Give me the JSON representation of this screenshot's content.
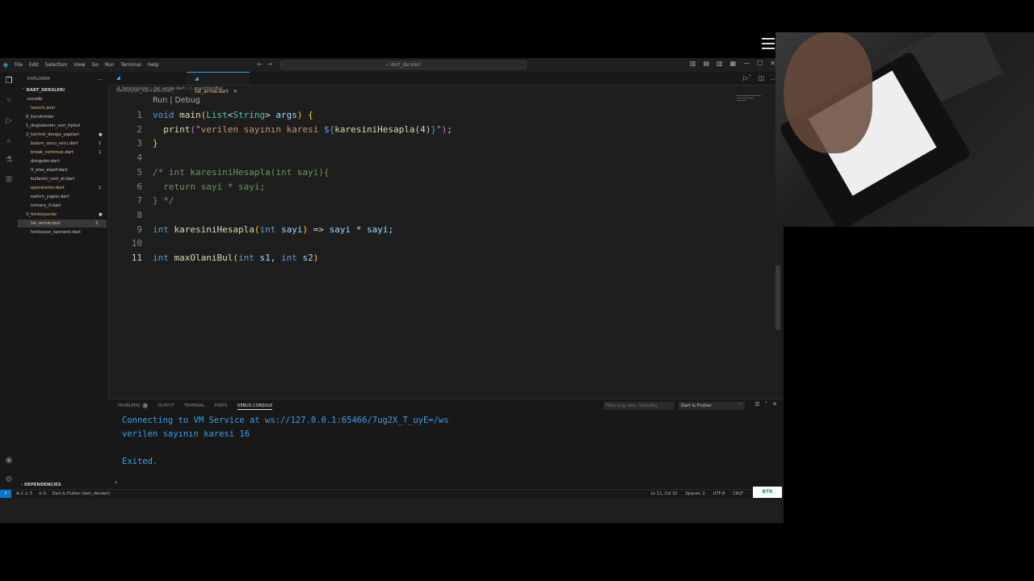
{
  "titlebar": {
    "menu": [
      "File",
      "Edit",
      "Selection",
      "View",
      "Go",
      "Run",
      "Terminal",
      "Help"
    ],
    "search": "dart_dersleri"
  },
  "sidebar": {
    "header": "EXPLORER",
    "project": "DART_DERSLERI",
    "items": [
      {
        "label": ".vscode",
        "color": "#cccccc",
        "indent": 1,
        "badge": ""
      },
      {
        "label": "launch.json",
        "color": "#e5c07b",
        "indent": 2,
        "badge": ""
      },
      {
        "label": "0_kurulumlar",
        "color": "#cccccc",
        "indent": 1,
        "badge": ""
      },
      {
        "label": "1_degiskenler_veri_tipleri",
        "color": "#cccccc",
        "indent": 1,
        "badge": ""
      },
      {
        "label": "2_kontrol_dongu_yapilari",
        "color": "#e2c08d",
        "indent": 1,
        "badge": "●"
      },
      {
        "label": "bolum_sonu_soru.dart",
        "color": "#e2c08d",
        "indent": 2,
        "badge": "1"
      },
      {
        "label": "break_continue.dart",
        "color": "#e2c08d",
        "indent": 2,
        "badge": "1"
      },
      {
        "label": "donguler.dart",
        "color": "#cccccc",
        "indent": 2,
        "badge": ""
      },
      {
        "label": "if_else_elseif.dart",
        "color": "#cccccc",
        "indent": 2,
        "badge": ""
      },
      {
        "label": "kullanici_veri_al.dart",
        "color": "#cccccc",
        "indent": 2,
        "badge": ""
      },
      {
        "label": "operatorler.dart",
        "color": "#e2c08d",
        "indent": 2,
        "badge": "1"
      },
      {
        "label": "switch_yapisi.dart",
        "color": "#cccccc",
        "indent": 2,
        "badge": ""
      },
      {
        "label": "ternary_if.dart",
        "color": "#cccccc",
        "indent": 2,
        "badge": ""
      },
      {
        "label": "3_fonksiyonlar",
        "color": "#e2c08d",
        "indent": 1,
        "badge": "●"
      },
      {
        "label": "fat_arrow.dart",
        "color": "#e2c08d",
        "indent": 2,
        "badge": "2",
        "selected": true
      },
      {
        "label": "fonksiyon_kavrami.dart",
        "color": "#cccccc",
        "indent": 2,
        "badge": ""
      }
    ],
    "dependencies": "DEPENDENCIES"
  },
  "tabs": [
    {
      "label": "fonksiyon_kavrami.dart",
      "active": false
    },
    {
      "label": "fat_arrow.dart",
      "active": true
    }
  ],
  "breadcrumb": "3_fonksiyonlar  ›  fat_arrow.dart  ›  ◇ maxOlaniBul",
  "editor": {
    "codelens": "Run | Debug",
    "lines": [
      {
        "n": "1",
        "tokens": [
          [
            "kw",
            "void "
          ],
          [
            "fn",
            "main"
          ],
          [
            "br",
            "("
          ],
          [
            "ty",
            "List"
          ],
          [
            "pl",
            "<"
          ],
          [
            "ty",
            "String"
          ],
          [
            "pl",
            "> "
          ],
          [
            "vr",
            "args"
          ],
          [
            "br",
            ")"
          ],
          [
            "pl",
            " "
          ],
          [
            "br",
            "{"
          ]
        ]
      },
      {
        "n": "2",
        "tokens": [
          [
            "pl",
            "  "
          ],
          [
            "fn",
            "print"
          ],
          [
            "bp",
            "("
          ],
          [
            "st",
            "\"verilen sayının karesi "
          ],
          [
            "kw",
            "${"
          ],
          [
            "fn",
            "karesiniHesapla"
          ],
          [
            "pl",
            "(4)"
          ],
          [
            "kw",
            "}"
          ],
          [
            "st",
            "\""
          ],
          [
            "bp",
            ")"
          ],
          [
            "pl",
            ";"
          ]
        ]
      },
      {
        "n": "3",
        "tokens": [
          [
            "br",
            "}"
          ]
        ]
      },
      {
        "n": "4",
        "tokens": []
      },
      {
        "n": "5",
        "tokens": [
          [
            "cm",
            "/* int karesiniHesapla(int sayi){"
          ]
        ]
      },
      {
        "n": "6",
        "tokens": [
          [
            "cm",
            "  return sayi * sayi;"
          ]
        ]
      },
      {
        "n": "7",
        "tokens": [
          [
            "cm",
            "} */"
          ]
        ]
      },
      {
        "n": "8",
        "tokens": []
      },
      {
        "n": "9",
        "tokens": [
          [
            "kw",
            "int "
          ],
          [
            "fn",
            "karesiniHesapla"
          ],
          [
            "br",
            "("
          ],
          [
            "kw",
            "int "
          ],
          [
            "vr",
            "sayi"
          ],
          [
            "br",
            ")"
          ],
          [
            "pl",
            " => "
          ],
          [
            "vr",
            "sayi"
          ],
          [
            "pl",
            " * "
          ],
          [
            "vr",
            "sayi"
          ],
          [
            "pl",
            ";"
          ]
        ]
      },
      {
        "n": "10",
        "tokens": []
      },
      {
        "n": "11",
        "tokens": [
          [
            "kw",
            "int "
          ],
          [
            "fn",
            "maxOlaniBul"
          ],
          [
            "br",
            "("
          ],
          [
            "kw",
            "int "
          ],
          [
            "vr",
            "s1"
          ],
          [
            "pl",
            ", "
          ],
          [
            "kw",
            "int "
          ],
          [
            "vr",
            "s2"
          ],
          [
            "br",
            ")"
          ]
        ]
      }
    ]
  },
  "panel": {
    "tabs": [
      "PROBLEMS",
      "OUTPUT",
      "TERMINAL",
      "PORTS",
      "DEBUG CONSOLE"
    ],
    "problems_count": "3",
    "filter_placeholder": "Filter (e.g. text, !exclude)",
    "selected": "Dart & Flutter",
    "console": [
      "Connecting to VM Service at ws://127.0.0.1:65466/7ug2X_T_uyE=/ws",
      "verilen sayının karesi 16",
      "",
      "Exited."
    ]
  },
  "statusbar": {
    "errors": "⊗ 2 ⚠ 3",
    "ports": "⊘ 0",
    "flutter": "Dart & Flutter (dart_dersleri)",
    "position": "Ln 11, Col 32",
    "spaces": "Spaces: 2",
    "encoding": "UTF-8",
    "eol": "CRLF",
    "brand": "BTK"
  },
  "colors": {
    "accent": "#3b9fe8",
    "modified": "#e2c08d"
  }
}
